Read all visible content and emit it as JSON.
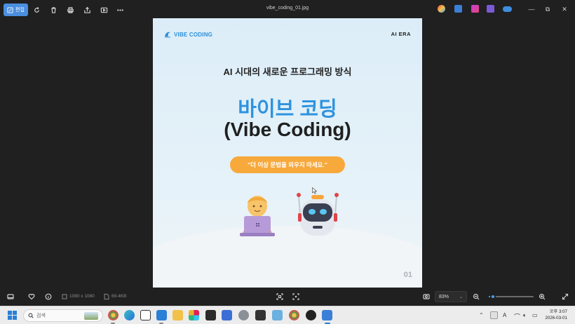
{
  "toolbar": {
    "edit_label": "편집",
    "file_name": "vibe_coding_01.jpg",
    "icons": [
      "rotate-icon",
      "delete-icon",
      "print-icon",
      "share-icon",
      "slideshow-icon",
      "more-icon"
    ]
  },
  "window_controls": {
    "minimize": "—",
    "restore": "⧉",
    "close": "✕"
  },
  "image": {
    "brand": "VIBE CODING",
    "corner_label": "AI ERA",
    "subtitle": "AI 시대의 새로운 프로그래밍 방식",
    "title": "바이브 코딩",
    "title_en": "(Vibe Coding)",
    "quote": "\"더 이상 문법을 외우지 마세요.\"",
    "page_number": "01",
    "colors": {
      "accent": "#2e93de",
      "quote_bg": "#f7a93c"
    }
  },
  "statusbar": {
    "dimensions": "1080 x 1080",
    "file_size": "69.4KB",
    "zoom": "83%",
    "zoom_level": 0.1
  },
  "taskbar": {
    "search_placeholder": "검색",
    "time": "오후 3:07",
    "date": "2026-03-01",
    "ime": "A"
  }
}
